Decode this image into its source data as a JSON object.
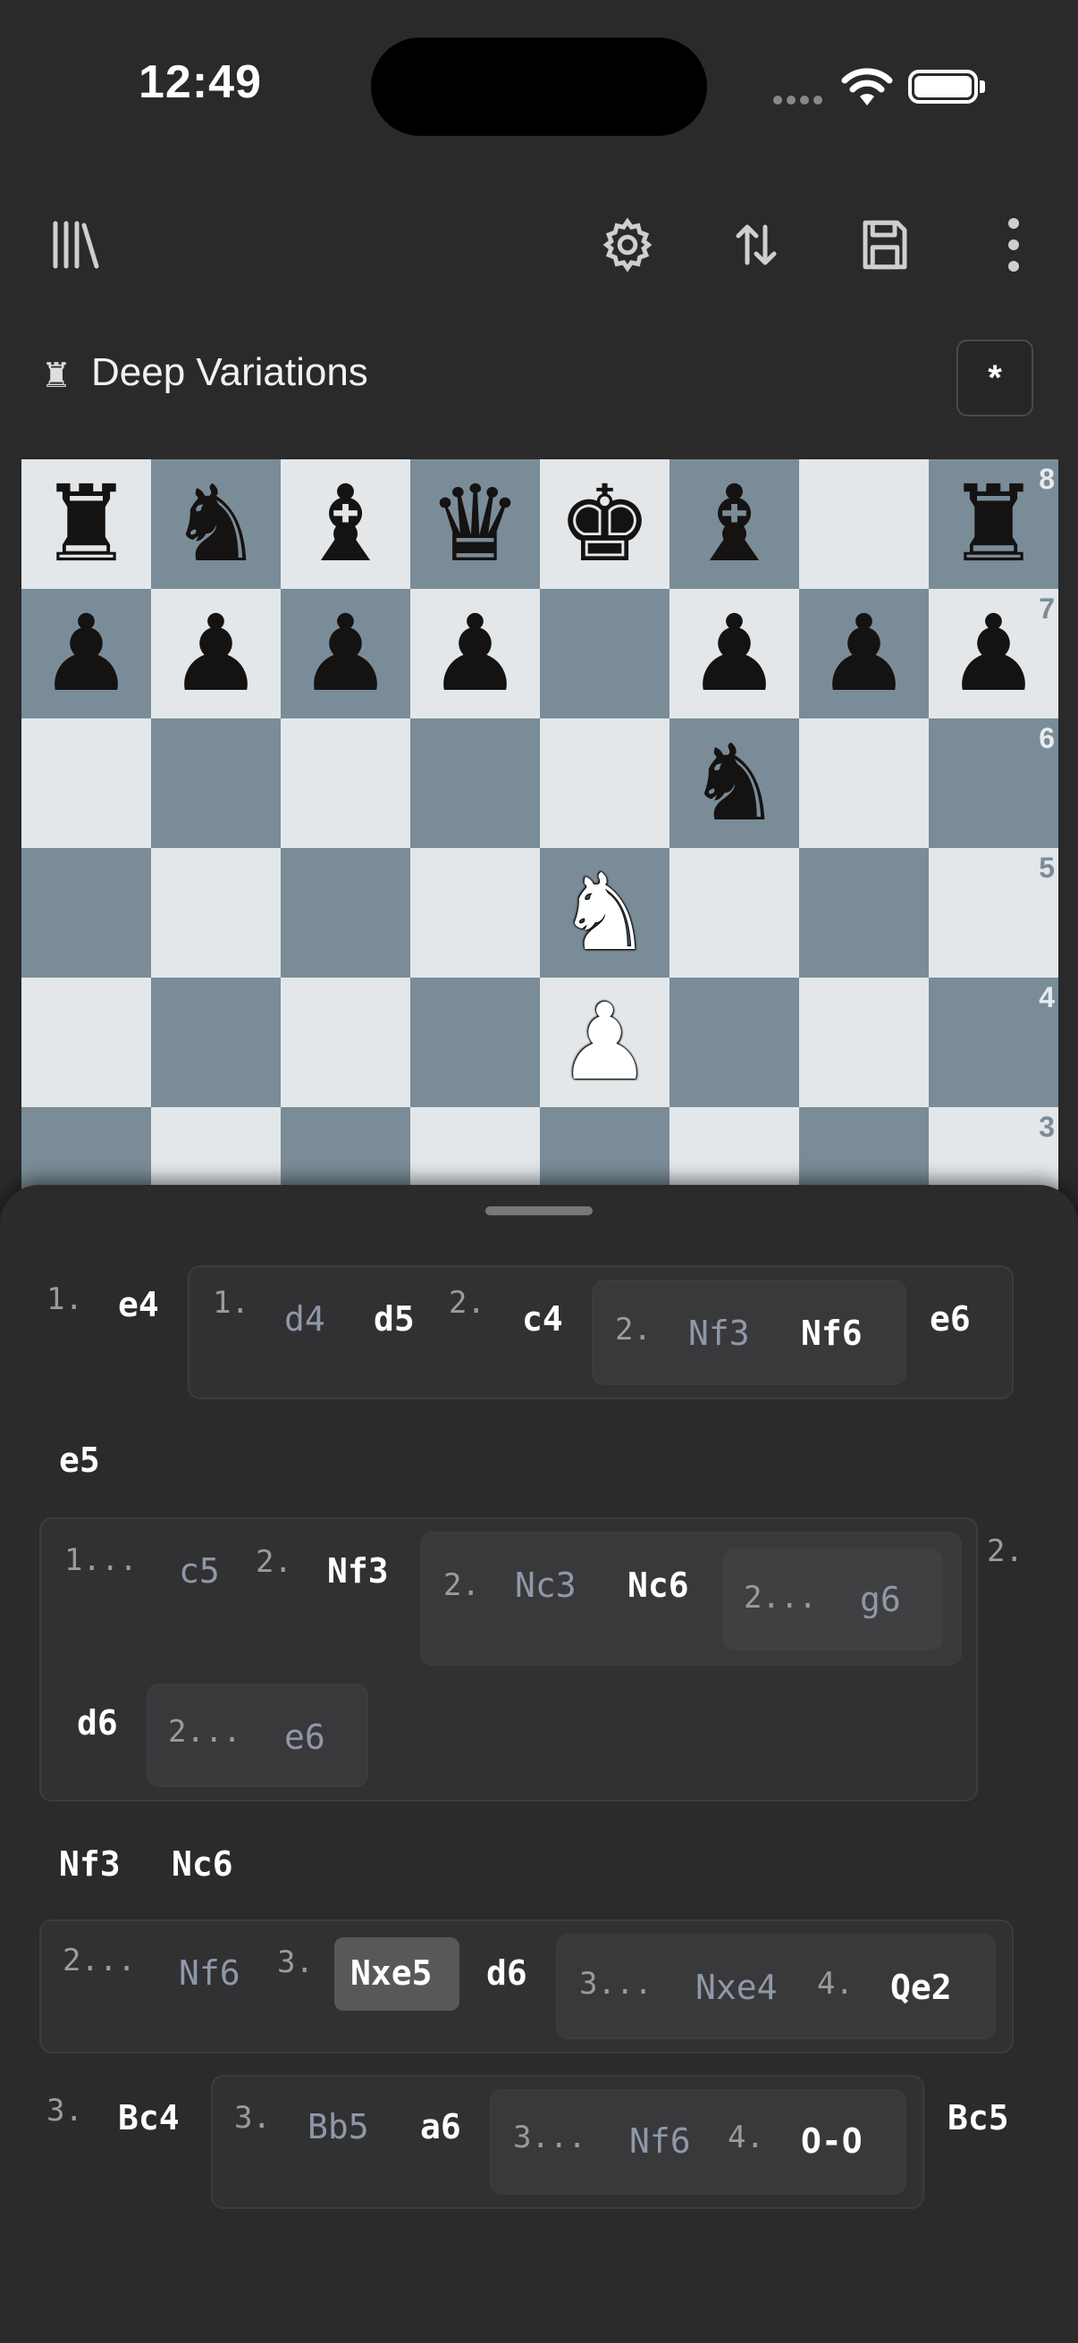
{
  "status_bar": {
    "time": "12:49"
  },
  "toolbar": {
    "library": "library-icon",
    "settings": "gear-icon",
    "flip": "flip-board-icon",
    "save": "save-icon",
    "more": "more-vertical-icon"
  },
  "game": {
    "title": "Deep Variations",
    "result": "*"
  },
  "board": {
    "ranks": [
      "8",
      "7",
      "6",
      "5",
      "4",
      "3"
    ],
    "pieces": [
      {
        "sq": "a8",
        "p": "r"
      },
      {
        "sq": "b8",
        "p": "n"
      },
      {
        "sq": "c8",
        "p": "b"
      },
      {
        "sq": "d8",
        "p": "q"
      },
      {
        "sq": "e8",
        "p": "k"
      },
      {
        "sq": "f8",
        "p": "b"
      },
      {
        "sq": "h8",
        "p": "r"
      },
      {
        "sq": "a7",
        "p": "p"
      },
      {
        "sq": "b7",
        "p": "p"
      },
      {
        "sq": "c7",
        "p": "p"
      },
      {
        "sq": "d7",
        "p": "p"
      },
      {
        "sq": "f7",
        "p": "p"
      },
      {
        "sq": "g7",
        "p": "p"
      },
      {
        "sq": "h7",
        "p": "p"
      },
      {
        "sq": "f6",
        "p": "n"
      },
      {
        "sq": "e5",
        "p": "N"
      },
      {
        "sq": "e4",
        "p": "P"
      }
    ]
  },
  "moves": {
    "m1_num": "1.",
    "m1": "e4",
    "v1_num": "1.",
    "v1_a": "d4",
    "v1_b": "d5",
    "v1_num2": "2.",
    "v1_c": "c4",
    "v1s_num": "2.",
    "v1s_a": "Nf3",
    "v1s_b": "Nf6",
    "v1_d": "e6",
    "m1b": "e5",
    "v2_num": "1...",
    "v2_a": "c5",
    "v2_num2": "2.",
    "v2_b": "Nf3",
    "v2s_num": "2.",
    "v2s_a": "Nc3",
    "v2s_b": "Nc6",
    "v2ss_num": "2...",
    "v2ss_a": "g6",
    "v2_num3": "2.",
    "v2_c": "d6",
    "v2t_num": "2...",
    "v2t_a": "e6",
    "m2": "Nf3",
    "m2b": "Nc6",
    "v3_num": "2...",
    "v3_a": "Nf6",
    "v3_num2": "3.",
    "v3_b": "Nxe5",
    "v3_c": "d6",
    "v3s_num": "3...",
    "v3s_a": "Nxe4",
    "v3s_num2": "4.",
    "v3s_b": "Qe2",
    "m3_num": "3.",
    "m3": "Bc4",
    "v4_num": "3.",
    "v4_a": "Bb5",
    "v4_b": "a6",
    "v4s_num": "3...",
    "v4s_a": "Nf6",
    "v4s_num2": "4.",
    "v4s_b": "O-O",
    "m3b": "Bc5"
  }
}
